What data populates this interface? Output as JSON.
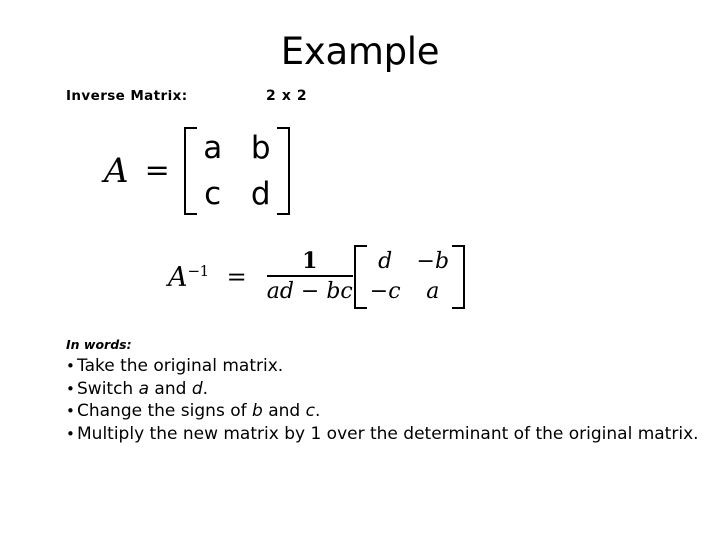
{
  "slide": {
    "title": "Example",
    "labels": {
      "topic": "Inverse Matrix:",
      "dimensions": "2 x 2"
    },
    "equation_matrix": {
      "lhs": "A",
      "equals": "=",
      "entries": [
        "a",
        "b",
        "c",
        "d"
      ]
    },
    "equation_inverse": {
      "lhs_base": "A",
      "lhs_exponent": "−1",
      "equals": "=",
      "fraction_numerator": "1",
      "fraction_denominator": "ad − bc",
      "entries": [
        "d",
        "−b",
        "−c",
        "a"
      ]
    },
    "in_words": {
      "heading": "In words:",
      "bullet_char": "•",
      "items": [
        {
          "pre": "Take the original matrix.",
          "var1": "",
          "mid": "",
          "var2": "",
          "post": ""
        },
        {
          "pre": "Switch ",
          "var1": "a",
          "mid": " and ",
          "var2": "d",
          "post": "."
        },
        {
          "pre": "Change the signs of ",
          "var1": "b",
          "mid": " and ",
          "var2": "c",
          "post": "."
        },
        {
          "pre": "Multiply the new matrix by  1  over the determinant of the original matrix.",
          "var1": "",
          "mid": "",
          "var2": "",
          "post": ""
        }
      ]
    }
  }
}
